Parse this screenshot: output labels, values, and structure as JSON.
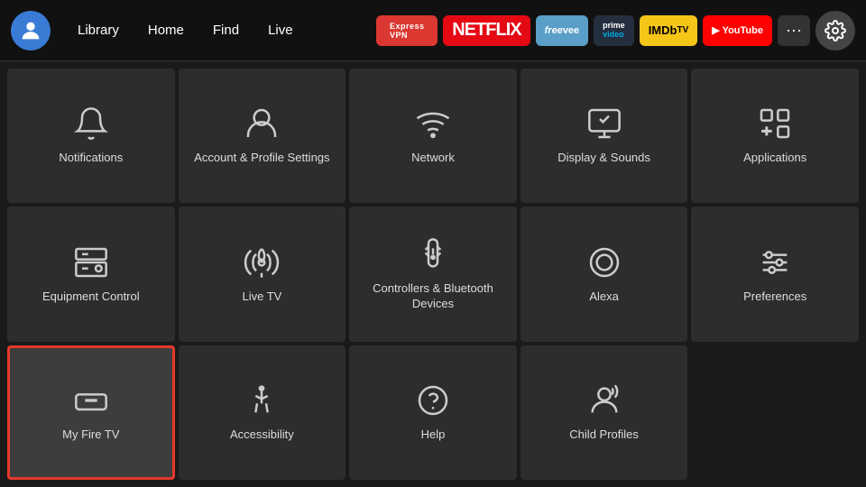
{
  "topbar": {
    "nav_items": [
      "Library",
      "Home",
      "Find",
      "Live"
    ],
    "apps": [
      {
        "id": "expressvpn",
        "label": "ExpressVPN"
      },
      {
        "id": "netflix",
        "label": "NETFLIX"
      },
      {
        "id": "freevee",
        "label": "freevee"
      },
      {
        "id": "prime",
        "label": "prime video"
      },
      {
        "id": "imdb",
        "label": "IMDbTV"
      },
      {
        "id": "youtube",
        "label": "▶ YouTube"
      }
    ],
    "more_label": "···",
    "gear_label": "⚙"
  },
  "grid": {
    "items": [
      {
        "id": "notifications",
        "label": "Notifications",
        "icon": "bell"
      },
      {
        "id": "account-profile",
        "label": "Account & Profile Settings",
        "icon": "user"
      },
      {
        "id": "network",
        "label": "Network",
        "icon": "wifi"
      },
      {
        "id": "display-sounds",
        "label": "Display & Sounds",
        "icon": "display"
      },
      {
        "id": "applications",
        "label": "Applications",
        "icon": "apps"
      },
      {
        "id": "equipment-control",
        "label": "Equipment Control",
        "icon": "tv"
      },
      {
        "id": "live-tv",
        "label": "Live TV",
        "icon": "antenna"
      },
      {
        "id": "controllers-bluetooth",
        "label": "Controllers & Bluetooth Devices",
        "icon": "remote"
      },
      {
        "id": "alexa",
        "label": "Alexa",
        "icon": "alexa"
      },
      {
        "id": "preferences",
        "label": "Preferences",
        "icon": "sliders"
      },
      {
        "id": "my-fire-tv",
        "label": "My Fire TV",
        "icon": "firetv",
        "selected": true
      },
      {
        "id": "accessibility",
        "label": "Accessibility",
        "icon": "accessibility"
      },
      {
        "id": "help",
        "label": "Help",
        "icon": "help"
      },
      {
        "id": "child-profiles",
        "label": "Child Profiles",
        "icon": "child"
      }
    ]
  }
}
